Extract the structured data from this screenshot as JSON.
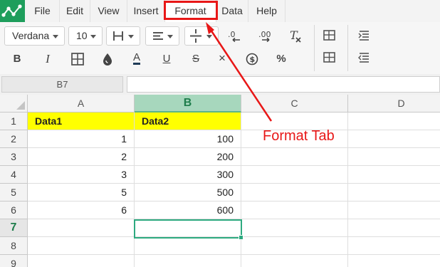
{
  "menu": {
    "items": [
      {
        "label": "File"
      },
      {
        "label": "Edit"
      },
      {
        "label": "View"
      },
      {
        "label": "Insert"
      },
      {
        "label": "Format"
      },
      {
        "label": "Data"
      },
      {
        "label": "Help"
      }
    ],
    "active": "Format"
  },
  "toolbar": {
    "font_name": "Verdana",
    "font_size": "10",
    "icons": {
      "borders": "border-style-icon",
      "halign": "align-left-icon",
      "valign": "vertical-align-icon",
      "dec_decrease": "decrease-decimals-icon",
      "dec_increase": "increase-decimals-icon",
      "clear": "clear-format-icon",
      "bold": "B",
      "italic": "I",
      "cell_borders": "cell-borders-icon",
      "fill": "fill-color-icon",
      "text_color": "A",
      "underline": "U",
      "strike": "S",
      "cross": "×",
      "currency": "$",
      "percent": "%",
      "table": "table-icon",
      "table2": "table-grid-icon",
      "indent_increase": "indent-increase-icon",
      "indent_decrease": "indent-decrease-icon"
    }
  },
  "formula_bar": {
    "cell_ref": "B7",
    "value": ""
  },
  "grid": {
    "columns": [
      "A",
      "B",
      "C",
      "D"
    ],
    "selected_column": "B",
    "rows": [
      "1",
      "2",
      "3",
      "4",
      "5",
      "6",
      "7",
      "8",
      "9"
    ],
    "selected_row": "7",
    "cells": {
      "A1": "Data1",
      "B1": "Data2",
      "A2": "1",
      "B2": "100",
      "A3": "2",
      "B3": "200",
      "A4": "3",
      "B4": "300",
      "A5": "5",
      "B5": "500",
      "A6": "6",
      "B6": "600"
    }
  },
  "annotation": {
    "label": "Format Tab",
    "color": "#e81717"
  },
  "colors": {
    "logo": "#1e9e5c",
    "header_highlight": "#ffff00",
    "selection": "#2eaa80"
  }
}
